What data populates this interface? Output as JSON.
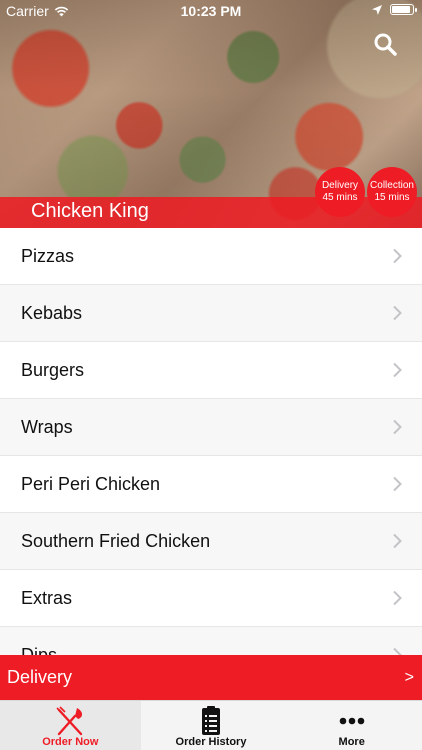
{
  "status_bar": {
    "carrier": "Carrier",
    "time": "10:23 PM"
  },
  "header": {
    "restaurant_name": "Chicken King",
    "delivery_badge": {
      "label": "Delivery",
      "time": "45 mins"
    },
    "collection_badge": {
      "label": "Collection",
      "time": "15 mins"
    },
    "search_icon": "search-icon"
  },
  "menu": {
    "categories": [
      {
        "label": "Pizzas"
      },
      {
        "label": "Kebabs"
      },
      {
        "label": "Burgers"
      },
      {
        "label": "Wraps"
      },
      {
        "label": "Peri Peri Chicken"
      },
      {
        "label": "Southern Fried Chicken"
      },
      {
        "label": "Extras"
      },
      {
        "label": "Dips"
      }
    ]
  },
  "delivery_bar": {
    "label": "Delivery",
    "arrow": ">"
  },
  "tabs": [
    {
      "label": "Order Now",
      "icon": "fork-knife-icon",
      "active": true
    },
    {
      "label": "Order History",
      "icon": "receipt-icon",
      "active": false
    },
    {
      "label": "More",
      "icon": "more-icon",
      "active": false
    }
  ],
  "colors": {
    "accent": "#ee1c25",
    "tab_background": "#f4f4f4"
  }
}
